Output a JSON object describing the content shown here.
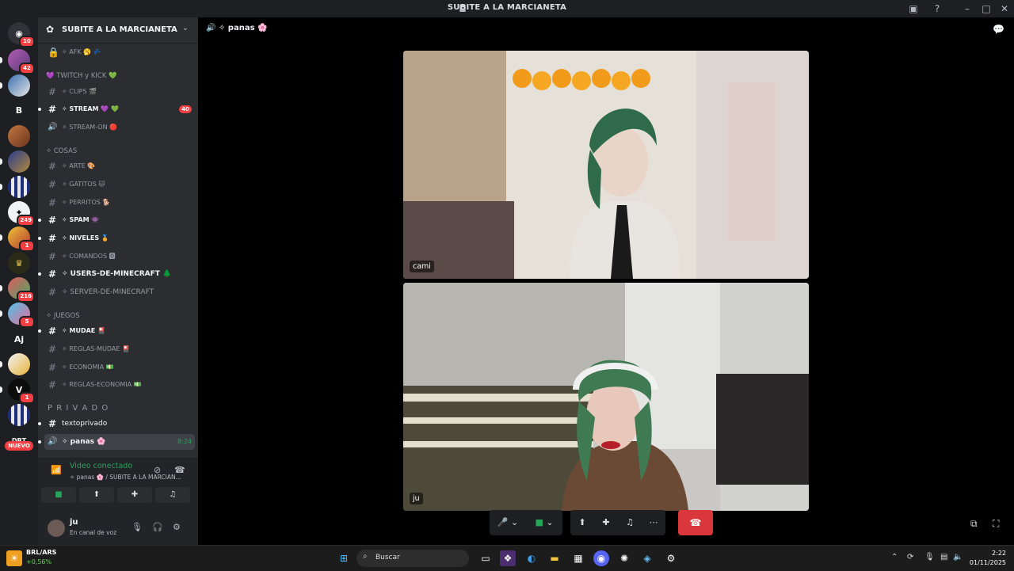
{
  "window": {
    "title": "SUBITE A LA MARCIANETA"
  },
  "rail": {
    "nuevo_label": "NUEVO",
    "servers": [
      {
        "name": "dm",
        "badge": "10"
      },
      {
        "name": "server-1",
        "badge": "42"
      },
      {
        "name": "server-2",
        "badge": ""
      },
      {
        "name": "server-b",
        "initial": "B",
        "badge": ""
      },
      {
        "name": "server-3",
        "badge": ""
      },
      {
        "name": "server-4",
        "badge": ""
      },
      {
        "name": "server-5",
        "badge": ""
      },
      {
        "name": "server-6",
        "badge": "249"
      },
      {
        "name": "server-7",
        "badge": "1"
      },
      {
        "name": "server-8",
        "badge": ""
      },
      {
        "name": "server-9",
        "badge": "216"
      },
      {
        "name": "server-10",
        "badge": "5"
      },
      {
        "name": "server-aj",
        "initial": "Aj",
        "badge": ""
      },
      {
        "name": "server-11",
        "badge": ""
      },
      {
        "name": "server-12",
        "badge": "1"
      },
      {
        "name": "server-13",
        "badge": ""
      },
      {
        "name": "server-dbt",
        "initial": "DBT",
        "badge": ""
      }
    ]
  },
  "sidebar": {
    "server_name": "SUBITE A LA MARCIANETA",
    "channels": {
      "afk": "✧ AFK 🥱 💤",
      "cat_twitch": "💜 TWITCH y KICK 💚",
      "clips": "✧ CLIPS 🎬",
      "stream": "✧ STREAM 💜 💚",
      "stream_mentions": "40",
      "stream_on": "✧ STREAM-ON 🔴",
      "cat_cosas": "✧ COSAS",
      "arte": "✧ ARTE 🎨",
      "gatitos": "✧ GATITOS 🐱",
      "perritos": "✧ PERRITOS 🐕",
      "spam": "✧ SPAM 👾",
      "niveles": "✧ NIVELES 🏅",
      "comandos": "✧ COMANDOS 🅾",
      "users_mc": "✧ USERS-DE-MINECRAFT 🌲",
      "server_mc": "✧ SERVER-DE-MINECRAFT",
      "cat_juegos": "✧ JUEGOS",
      "mudae": "✧ MUDAE 🎴",
      "reglas_mudae": "✧ REGLAS-MUDAE 🎴",
      "economia": "✧ ECONOMIA 💵",
      "reglas_economia": "✧ REGLAS-ECONOMIA 💵",
      "cat_privado": "P R I V A D O",
      "textoprivado": "textoprivado",
      "panas": "✧ panas 🌸",
      "panas_time": "8:24"
    },
    "voice": {
      "status": "Video conectado",
      "location": "✧ panas 🌸 / SUBITE A LA MARCIAN...",
      "buttons": [
        "camera-icon",
        "screenshare-icon",
        "activities-icon",
        "soundboard-icon"
      ]
    },
    "user": {
      "name": "ju",
      "status": "En canal de voz"
    }
  },
  "main": {
    "channel": "✧ panas 🌸",
    "participants": [
      {
        "name": "cami"
      },
      {
        "name": "ju"
      }
    ]
  },
  "taskbar": {
    "weather_title": "BRL/ARS",
    "weather_change": "+0,56%",
    "search_placeholder": "Buscar",
    "time": "2:22",
    "date": "01/11/2025"
  }
}
